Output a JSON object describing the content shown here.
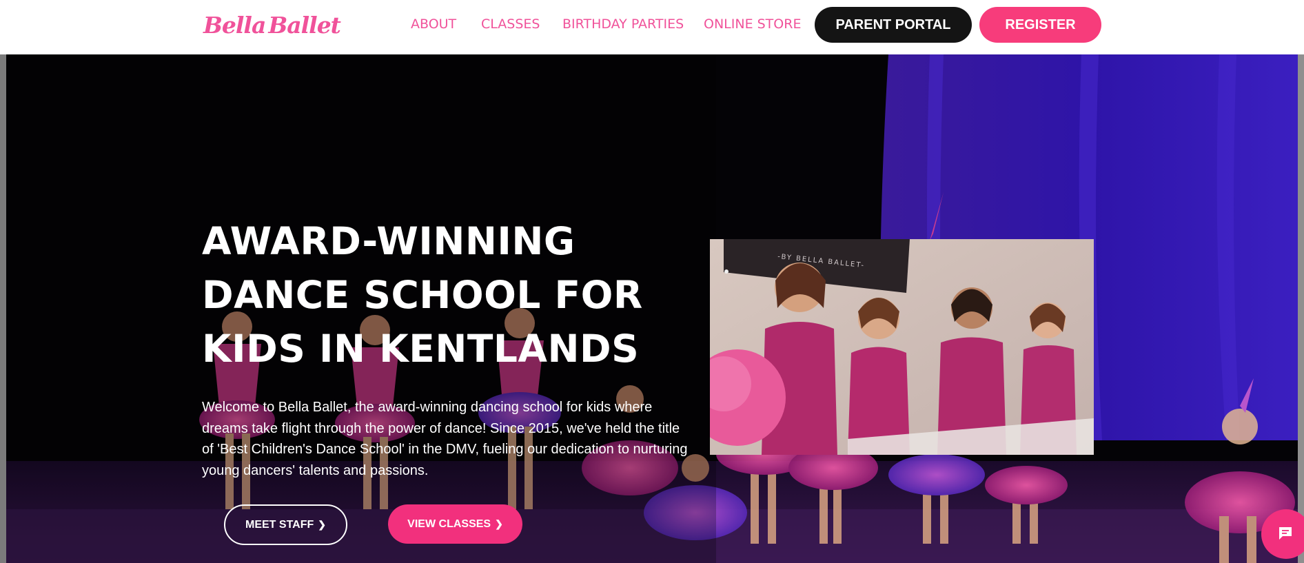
{
  "brand": {
    "logo_text_left": "Bella",
    "logo_text_right": "Ballet",
    "accent_color": "#f0529a",
    "dark_color": "#141414"
  },
  "nav": {
    "items": [
      {
        "label": "ABOUT"
      },
      {
        "label": "CLASSES"
      },
      {
        "label": "BIRTHDAY PARTIES"
      },
      {
        "label": "ONLINE STORE"
      }
    ],
    "portal_label": "PARENT PORTAL",
    "register_label": "REGISTER"
  },
  "hero": {
    "title_lines": [
      "AWARD-WINNING",
      "DANCE SCHOOL FOR",
      "KIDS IN KENTLANDS"
    ],
    "body_lines": [
      "Welcome to Bella Ballet, the award-winning dancing school for kids where",
      "dreams take flight through the power of dance! Since 2015, we've held the title",
      "of 'Best Children's Dance School' in the DMV, fueling our dedication to nurturing",
      "young dancers' talents and passions."
    ],
    "buttons": {
      "meet_staff": "MEET STAFF",
      "view_classes": "VIEW CLASSES",
      "chevron_icon": "chevron-right-icon"
    },
    "video": {
      "sign_text": "-BY BELLA BALLET-"
    }
  },
  "chat": {
    "icon": "chat-icon",
    "color": "#f2307d"
  }
}
